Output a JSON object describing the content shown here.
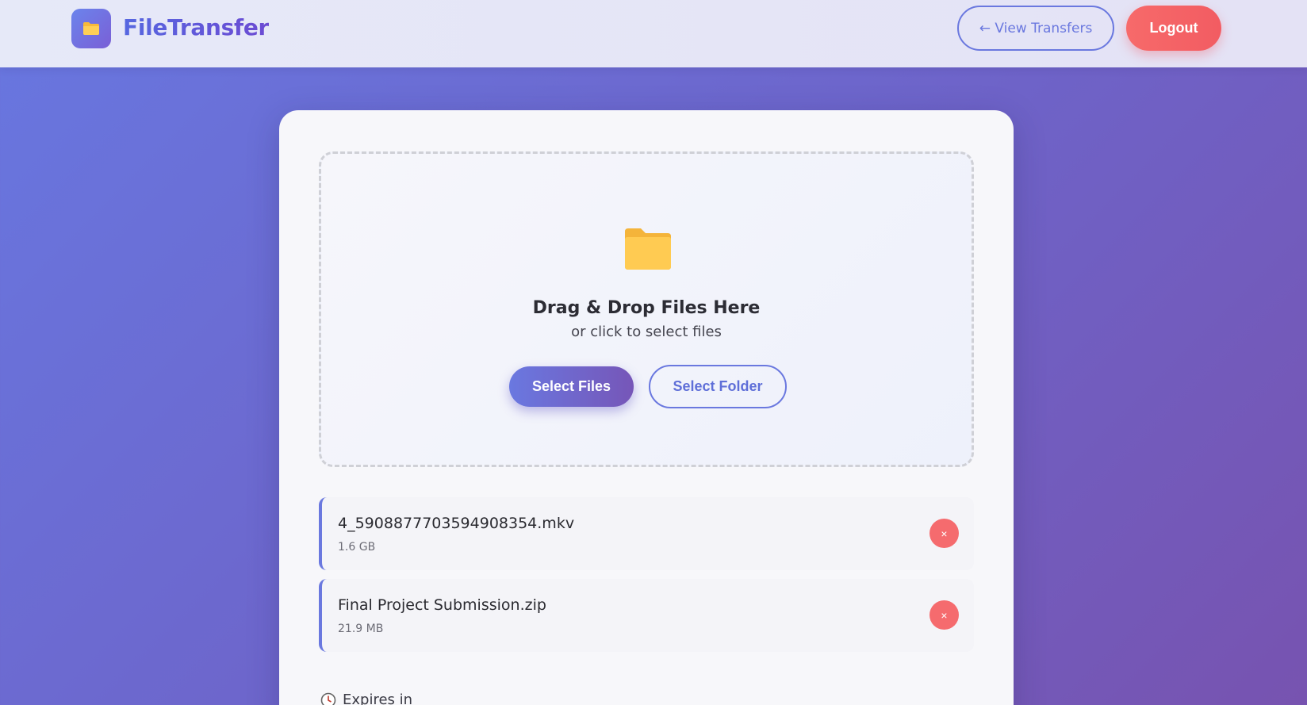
{
  "header": {
    "brand": "FileTransfer",
    "view_transfers_label": "← View Transfers",
    "logout_label": "Logout"
  },
  "dropzone": {
    "title": "Drag & Drop Files Here",
    "subtitle": "or click to select files",
    "select_files_label": "Select Files",
    "select_folder_label": "Select Folder"
  },
  "files": [
    {
      "name": "4_5908877703594908354.mkv",
      "size": "1.6 GB",
      "remove_label": "×"
    },
    {
      "name": "Final Project Submission.zip",
      "size": "21.9 MB",
      "remove_label": "×"
    }
  ],
  "expiry": {
    "label": "Expires in"
  },
  "colors": {
    "accent": "#6a78df",
    "danger": "#f56b6e",
    "folder": "#ffc64a"
  },
  "icons": {
    "logo": "folder-icon",
    "dropzone": "folder-icon",
    "expiry": "clock-icon"
  }
}
